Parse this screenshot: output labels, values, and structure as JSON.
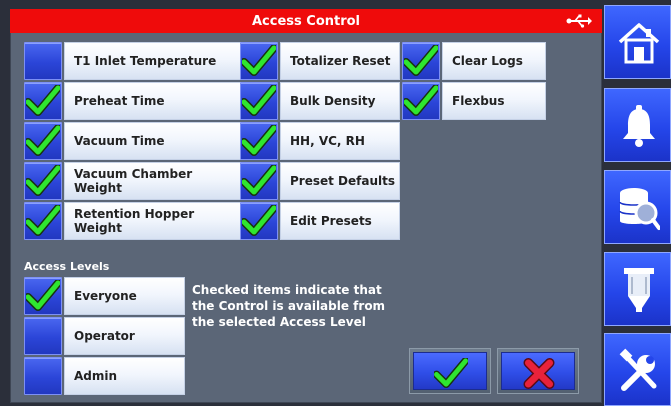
{
  "window": {
    "title": "Access Control"
  },
  "icons": {
    "usb": "usb-icon",
    "check": "checkmark-icon",
    "cross": "x-icon",
    "home": "home-icon",
    "alarm": "bell-icon",
    "search": "database-search-icon",
    "hopper": "hopper-icon",
    "settings": "tools-icon"
  },
  "colors": {
    "title_bar": "#ef0b0b",
    "panel": "#5b6677",
    "checkbox_blue": "#2b45d8",
    "check_green": "#2fe62f",
    "cross_red": "#e8223a",
    "nav_blue": "#2546ea"
  },
  "controls": {
    "col1": [
      {
        "label": "T1 Inlet Temperature",
        "checked": false
      },
      {
        "label": "Preheat Time",
        "checked": true
      },
      {
        "label": "Vacuum Time",
        "checked": true
      },
      {
        "label": "Vacuum Chamber Weight",
        "checked": true
      },
      {
        "label": "Retention Hopper Weight",
        "checked": true
      }
    ],
    "col2": [
      {
        "label": "Totalizer Reset",
        "checked": true
      },
      {
        "label": "Bulk Density",
        "checked": true
      },
      {
        "label": "HH, VC, RH",
        "checked": true
      },
      {
        "label": "Preset Defaults",
        "checked": true
      },
      {
        "label": "Edit Presets",
        "checked": true
      }
    ],
    "col3": [
      {
        "label": "Clear Logs",
        "checked": true
      },
      {
        "label": "Flexbus",
        "checked": true
      }
    ]
  },
  "access_levels": {
    "title": "Access Levels",
    "items": [
      {
        "label": "Everyone",
        "checked": true
      },
      {
        "label": "Operator",
        "checked": false
      },
      {
        "label": "Admin",
        "checked": false
      }
    ],
    "info": "Checked items indicate that the Control is available from the selected Access Level"
  },
  "sidebar": {
    "items": [
      "home",
      "alarms",
      "search",
      "hopper",
      "settings"
    ]
  }
}
